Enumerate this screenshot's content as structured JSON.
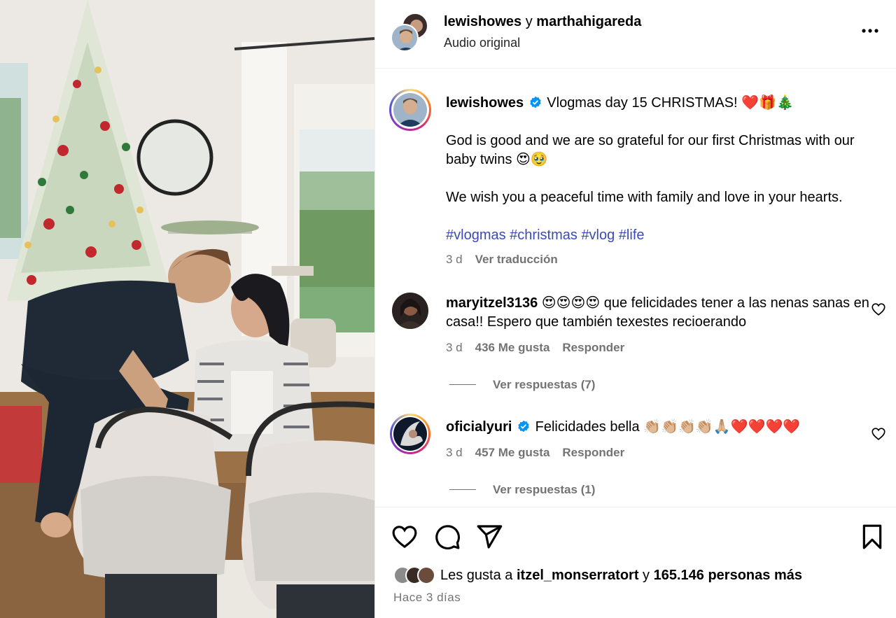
{
  "header": {
    "user1": "lewishowes",
    "conjunction": "y",
    "user2": "marthahigareda",
    "audio": "Audio original",
    "more_icon": "more-horizontal-icon"
  },
  "caption": {
    "username": "lewishowes",
    "title": "Vlogmas day 15 CHRISTMAS! ❤️🎁🎄",
    "paragraph1": "God is good and we are so grateful for our first Christmas with our baby twins 😍🥹",
    "paragraph2": "We wish you a peaceful time with family and love in your hearts.",
    "hashtags": [
      "#vlogmas",
      "#christmas",
      "#vlog",
      "#life"
    ],
    "time": "3 d",
    "translate": "Ver traducción"
  },
  "comments": [
    {
      "username": "maryitzel3136",
      "text": "😍😍😍😍 que felicidades tener a las nenas sanas en casa!! Espero que también texestes recioerando",
      "time": "3 d",
      "likes": "436 Me gusta",
      "reply": "Responder",
      "view_replies": "Ver respuestas (7)"
    },
    {
      "username": "oficialyuri",
      "verified": true,
      "text": "Felicidades bella 👏🏼👏🏼👏🏼👏🏼🙏🏼❤️❤️❤️❤️",
      "time": "3 d",
      "likes": "457 Me gusta",
      "reply": "Responder",
      "view_replies": "Ver respuestas (1)"
    }
  ],
  "footer": {
    "liked_prefix": "Les gusta a",
    "liked_user": "itzel_monserratort",
    "liked_and": "y",
    "liked_others": "165.146 personas más",
    "ago": "Hace 3 días"
  },
  "colors": {
    "hashtag": "#3b4ab8",
    "verified": "#0095f6",
    "muted": "#737373"
  }
}
